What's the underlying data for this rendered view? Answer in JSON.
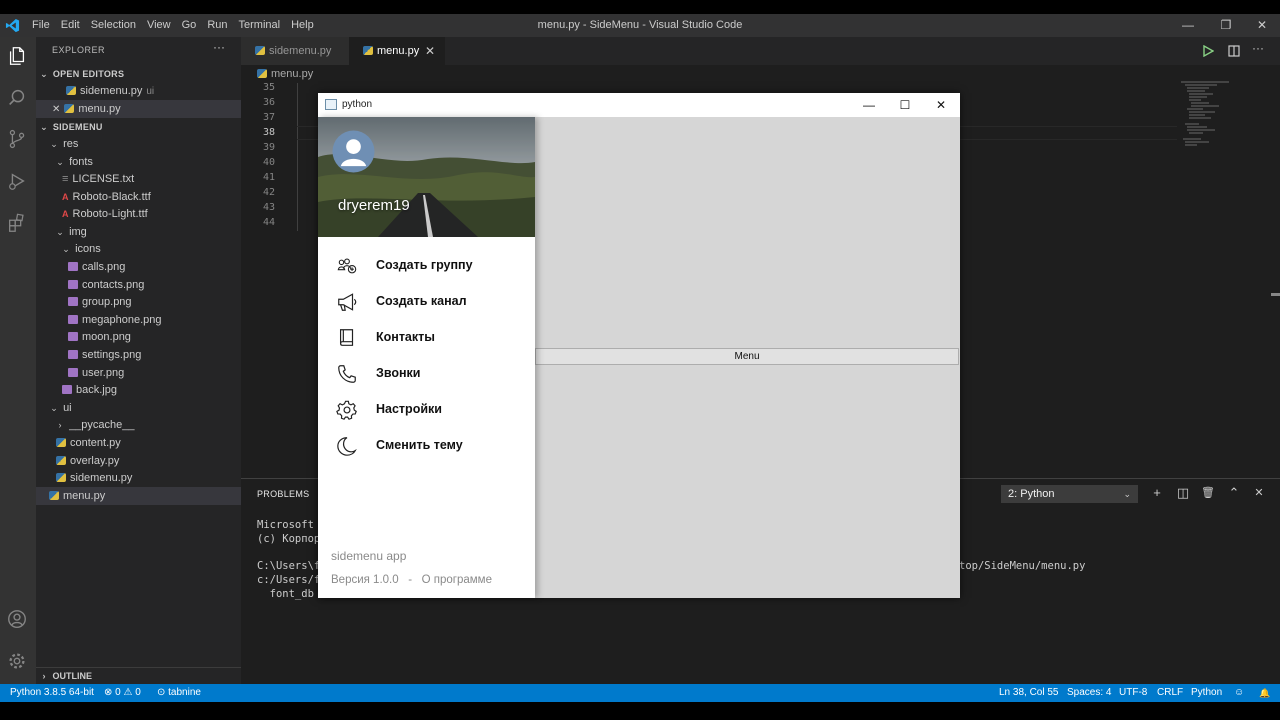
{
  "vscode": {
    "menu": [
      "File",
      "Edit",
      "Selection",
      "View",
      "Go",
      "Run",
      "Terminal",
      "Help"
    ],
    "window_title": "menu.py - SideMenu - Visual Studio Code",
    "window_controls": {
      "minimize": "—",
      "maximize": "❐",
      "close": "✕"
    },
    "explorer": {
      "header": "EXPLORER",
      "more": "···",
      "open_editors": "OPEN EDITORS",
      "open_files": [
        {
          "name": "sidemenu.py",
          "hint": "ui"
        },
        {
          "name": "menu.py",
          "close": "✕"
        }
      ],
      "project": "SIDEMENU",
      "tree": [
        {
          "name": "res",
          "chev": "⌄"
        },
        {
          "name": "fonts",
          "chev": "⌄"
        },
        {
          "name": "LICENSE.txt",
          "icon": "≡"
        },
        {
          "name": "Roboto-Black.ttf",
          "icon": "A"
        },
        {
          "name": "Roboto-Light.ttf",
          "icon": "A"
        },
        {
          "name": "img",
          "chev": "⌄"
        },
        {
          "name": "icons",
          "chev": "⌄"
        },
        {
          "name": "calls.png"
        },
        {
          "name": "contacts.png"
        },
        {
          "name": "group.png"
        },
        {
          "name": "megaphone.png"
        },
        {
          "name": "moon.png"
        },
        {
          "name": "settings.png"
        },
        {
          "name": "user.png"
        },
        {
          "name": "back.jpg"
        },
        {
          "name": "ui",
          "chev": "⌄"
        },
        {
          "name": "__pycache__",
          "chev": "›"
        },
        {
          "name": "content.py"
        },
        {
          "name": "overlay.py"
        },
        {
          "name": "sidemenu.py"
        },
        {
          "name": "menu.py"
        }
      ],
      "outline": "OUTLINE",
      "outline_chev": "›"
    },
    "tabs": [
      {
        "name": "sidemenu.py"
      },
      {
        "name": "menu.py",
        "close": "✕"
      }
    ],
    "breadcrumb": "menu.py",
    "line_numbers": [
      "35",
      "36",
      "37",
      "38",
      "39",
      "40",
      "41",
      "42",
      "43",
      "44"
    ],
    "panel": {
      "tab": "PROBLEMS",
      "terminal_select": "2: Python",
      "select_chev": "⌄",
      "buttons": {
        "add": "+",
        "split": "◫",
        "trash": "🗑",
        "up": "⌃",
        "close": "✕"
      },
      "lines": [
        "Microsoft W",
        "(c) Корпора",
        "C:\\Users\\fs",
        "c:/Users/fs",
        "  font_db ="
      ],
      "path_tail": "top/SideMenu/menu.py"
    },
    "status": {
      "python": "Python 3.8.5 64-bit",
      "problems": "⊗ 0 ⚠ 0",
      "tabnine": "⊙ tabnine",
      "position": "Ln 38, Col 55",
      "spaces": "Spaces: 4",
      "encoding": "UTF-8",
      "eol": "CRLF",
      "language": "Python",
      "feedback": "☺",
      "bell": "🔔"
    }
  },
  "app": {
    "title": "python",
    "controls": {
      "minimize": "—",
      "maximize": "☐",
      "close": "✕"
    },
    "menu_button": "Menu",
    "drawer": {
      "username": "dryerem19",
      "items": [
        {
          "label": "Создать группу",
          "icon": "group-icon"
        },
        {
          "label": "Создать канал",
          "icon": "megaphone-icon"
        },
        {
          "label": "Контакты",
          "icon": "contacts-icon"
        },
        {
          "label": "Звонки",
          "icon": "calls-icon"
        },
        {
          "label": "Настройки",
          "icon": "settings-icon"
        },
        {
          "label": "Сменить тему",
          "icon": "moon-icon"
        }
      ],
      "app_name": "sidemenu app",
      "version_line": "Версия 1.0.0   -   О программе"
    }
  }
}
